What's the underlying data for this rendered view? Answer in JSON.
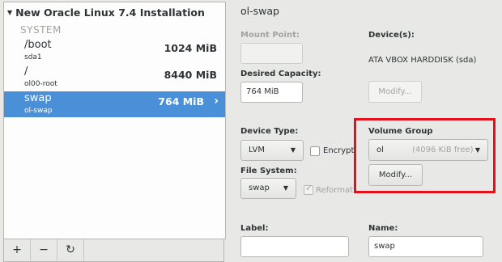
{
  "tree": {
    "header": "New Oracle Linux 7.4 Installation",
    "section": "SYSTEM",
    "mounts": [
      {
        "mount_point": "/boot",
        "device": "sda1",
        "size": "1024 MiB"
      },
      {
        "mount_point": "/",
        "device": "ol00-root",
        "size": "8440 MiB"
      },
      {
        "mount_point": "swap",
        "device": "ol-swap",
        "size": "764 MiB",
        "selected": true
      }
    ],
    "toolbar": {
      "add": "+",
      "remove": "−",
      "refresh": "↻"
    }
  },
  "details": {
    "title": "ol-swap",
    "mount_point_label": "Mount Point:",
    "mount_point_value": "",
    "desired_capacity_label": "Desired Capacity:",
    "desired_capacity_value": "764 MiB",
    "devices_label": "Device(s):",
    "devices_value": "ATA VBOX HARDDISK (sda)",
    "devices_modify": "Modify...",
    "device_type_label": "Device Type:",
    "device_type_value": "LVM",
    "encrypt_label": "Encrypt",
    "file_system_label": "File System:",
    "file_system_value": "swap",
    "reformat_label": "Reformat",
    "volume_group_label": "Volume Group",
    "volume_group_name": "ol",
    "volume_group_free": "(4096 KiB free)",
    "volume_group_modify": "Modify...",
    "label_label": "Label:",
    "label_value": "",
    "name_label": "Name:",
    "name_value": "swap"
  },
  "colors": {
    "selection": "#4a90d9",
    "highlight_box": "#e2111b"
  }
}
